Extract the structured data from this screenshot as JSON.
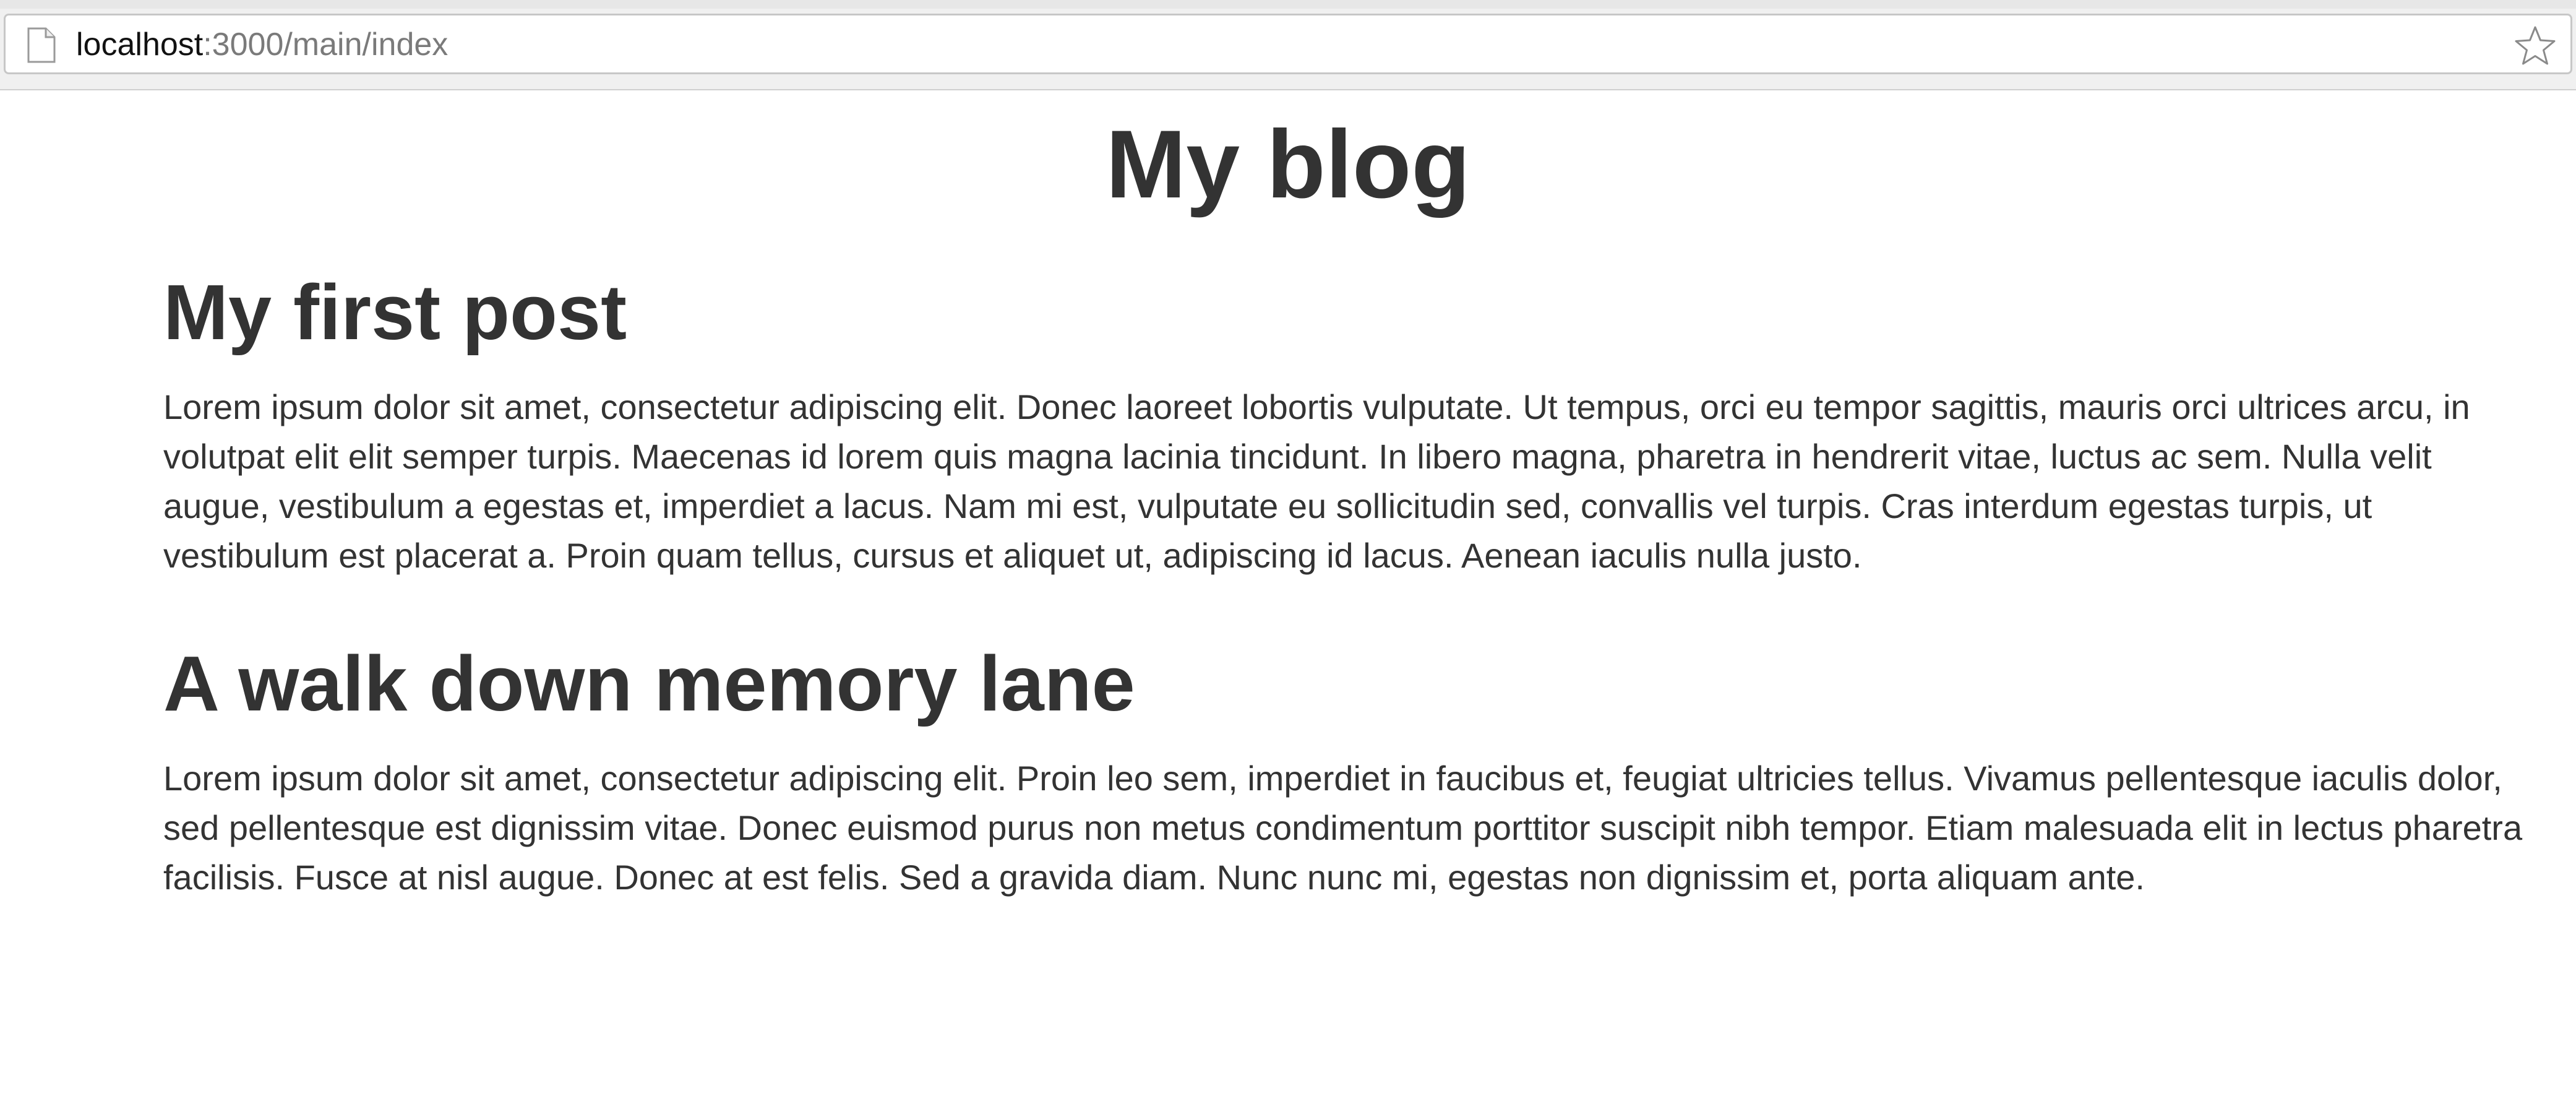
{
  "browser": {
    "url_host": "localhost",
    "url_rest": ":3000/main/index",
    "page_icon": "document-icon",
    "bookmark_icon": "star-icon"
  },
  "blog": {
    "title": "My blog"
  },
  "posts": [
    {
      "title": "My first post",
      "body": "Lorem ipsum dolor sit amet, consectetur adipiscing elit. Donec laoreet lobortis vulputate. Ut tempus, orci eu tempor sagittis, mauris orci ultrices arcu, in volutpat elit elit semper turpis. Maecenas id lorem quis magna lacinia tincidunt. In libero magna, pharetra in hendrerit vitae, luctus ac sem. Nulla velit augue, vestibulum a egestas et, imperdiet a lacus. Nam mi est, vulputate eu sollicitudin sed, convallis vel turpis. Cras interdum egestas turpis, ut vestibulum est placerat a. Proin quam tellus, cursus et aliquet ut, adipiscing id lacus. Aenean iaculis nulla justo."
    },
    {
      "title": "A walk down memory lane",
      "body": "Lorem ipsum dolor sit amet, consectetur adipiscing elit. Proin leo sem, imperdiet in faucibus et, feugiat ultricies tellus. Vivamus pellentesque iaculis dolor, sed pellentesque est dignissim vitae. Donec euismod purus non metus condimentum porttitor suscipit nibh tempor. Etiam malesuada elit in lectus pharetra facilisis. Fusce at nisl augue. Donec at est felis. Sed a gravida diam. Nunc nunc mi, egestas non dignissim et, porta aliquam ante."
    }
  ]
}
